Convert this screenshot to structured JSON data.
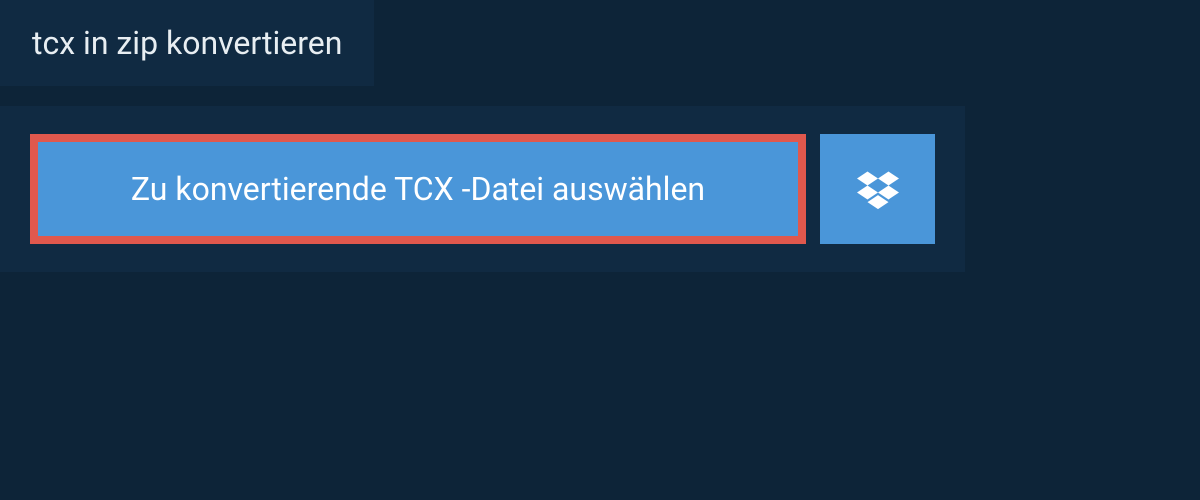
{
  "header": {
    "title": "tcx in zip konvertieren"
  },
  "actions": {
    "select_file_label": "Zu konvertierende TCX -Datei auswählen"
  },
  "colors": {
    "background": "#0d2438",
    "panel": "#102a42",
    "button_primary": "#4a96d9",
    "button_highlight_border": "#e0584d",
    "text_light": "#e8eef2",
    "text_white": "#ffffff"
  }
}
